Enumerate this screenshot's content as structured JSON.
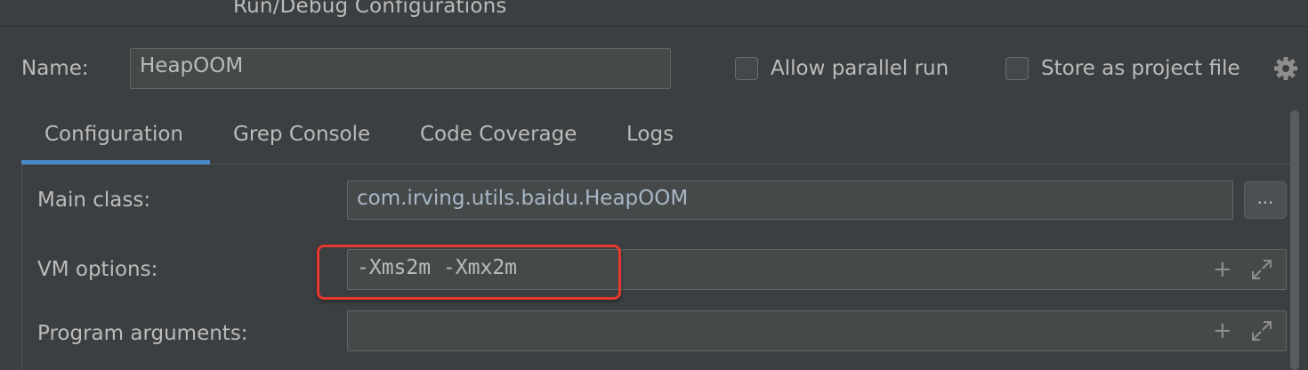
{
  "window": {
    "title": "Run/Debug Configurations"
  },
  "name_row": {
    "label": "Name:",
    "value": "HeapOOM",
    "allow_parallel_label": "Allow parallel run",
    "allow_parallel_checked": false,
    "store_project_label": "Store as project file",
    "store_project_checked": false
  },
  "tabs": [
    {
      "label": "Configuration",
      "active": true
    },
    {
      "label": "Grep Console",
      "active": false
    },
    {
      "label": "Code Coverage",
      "active": false
    },
    {
      "label": "Logs",
      "active": false
    }
  ],
  "form": {
    "main_class_label": "Main class:",
    "main_class_value": "com.irving.utils.baidu.HeapOOM",
    "browse_label": "...",
    "vm_options_label": "VM options:",
    "vm_options_value": "-Xms2m -Xmx2m",
    "program_args_label": "Program arguments:",
    "program_args_value": ""
  },
  "icons": {
    "gear": "gear-icon",
    "expand_plus": "plus-icon",
    "expand": "expand-icon"
  },
  "colors": {
    "background": "#3c3f41",
    "field": "#45494a",
    "accent": "#4a88c7",
    "highlight": "#e5392d",
    "text": "#bbbbbb"
  }
}
